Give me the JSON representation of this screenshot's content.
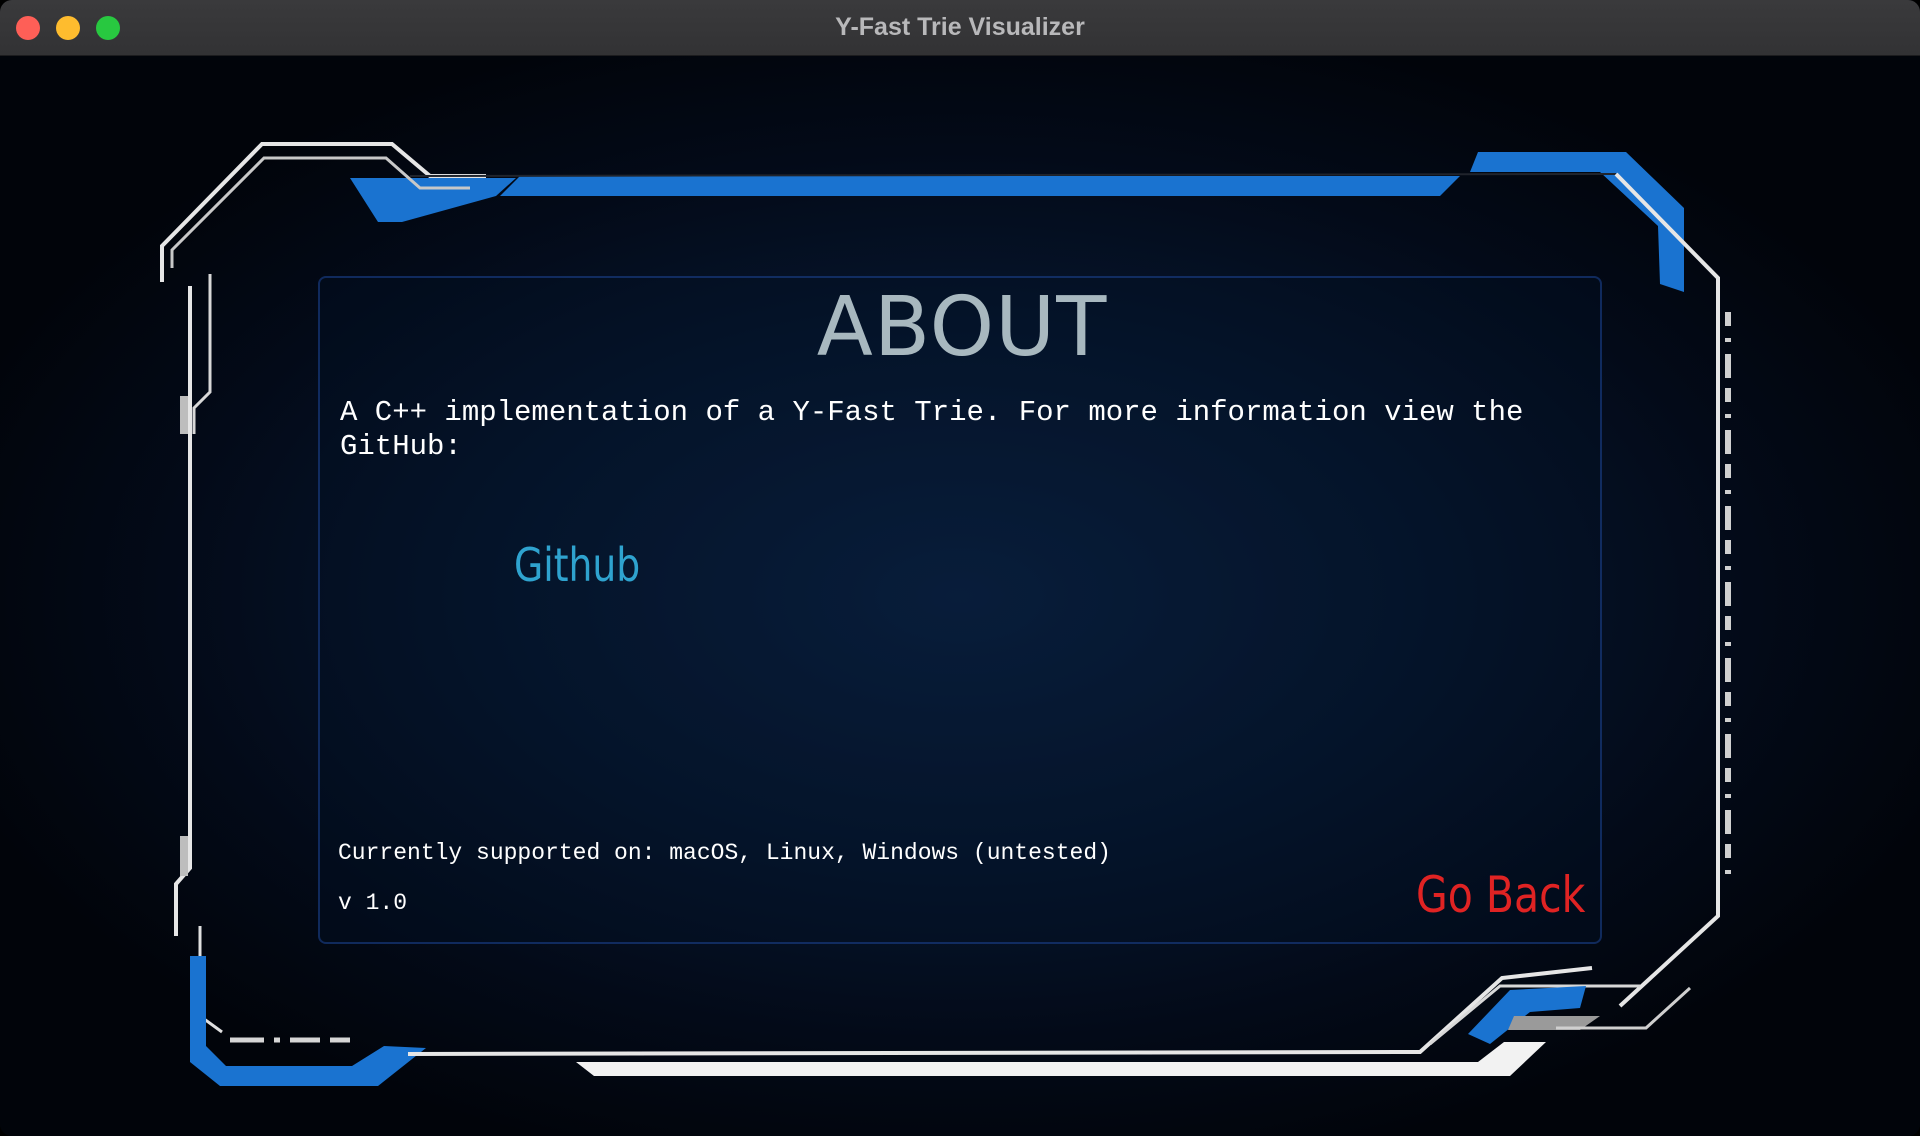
{
  "window": {
    "title": "Y-Fast Trie Visualizer"
  },
  "about": {
    "heading": "ABOUT",
    "description": "A C++ implementation of a Y-Fast Trie. For more information view the GitHub:",
    "github_link_label": "Github",
    "supported": "Currently supported on: macOS, Linux, Windows (untested)",
    "version": "v 1.0",
    "go_back_label": "Go Back"
  },
  "colors": {
    "background": "#02060f",
    "frame_accent": "#1a73d0",
    "frame_line": "#e6e6e6",
    "heading": "#a8b8bf",
    "link": "#2fa3cf",
    "go_back": "#e02323"
  }
}
